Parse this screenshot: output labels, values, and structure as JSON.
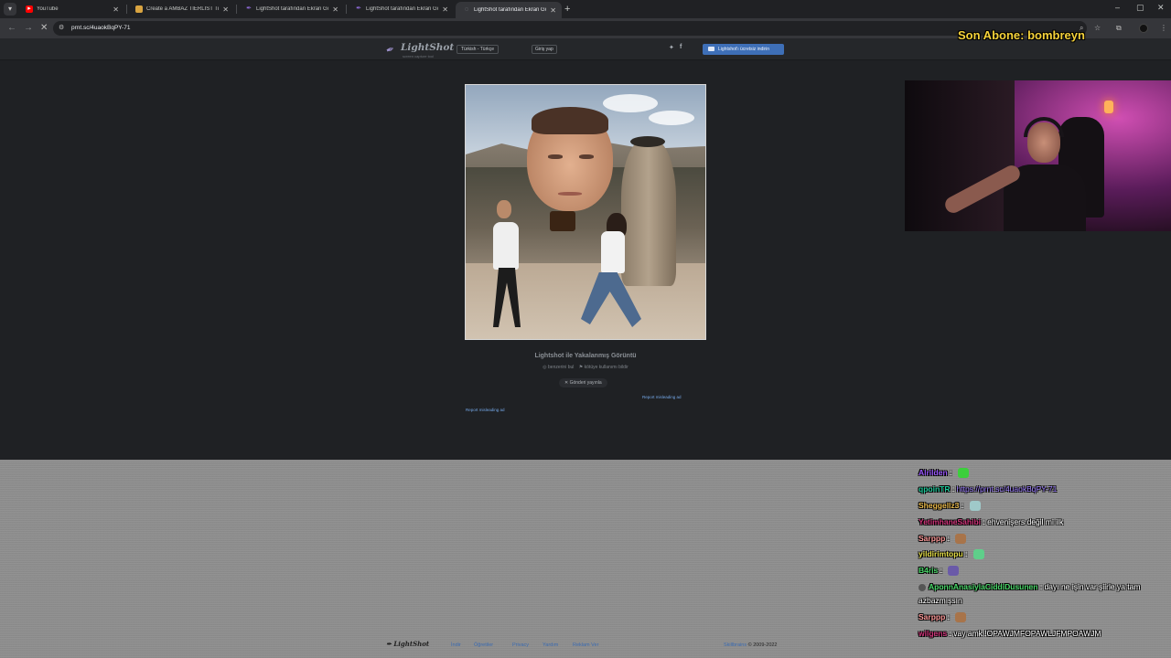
{
  "browser": {
    "tabs": [
      {
        "label": "YouTube",
        "active": false,
        "favicon": "youtube-icon",
        "color": "#ff0000"
      },
      {
        "label": "Create a AMBAZ TIERLIST Tier",
        "active": false,
        "favicon": "tiermaker-icon",
        "color": "#d9a441"
      },
      {
        "label": "LightShot tarafından Ekran Görü",
        "active": false,
        "favicon": "lightshot-icon",
        "color": "#8e6ad8"
      },
      {
        "label": "LightShot tarafından Ekran Görü",
        "active": false,
        "favicon": "lightshot-icon",
        "color": "#8e6ad8"
      },
      {
        "label": "LightShot tarafından Ekran Görü",
        "active": true,
        "favicon": "loading-icon",
        "color": "#9aa0a6"
      }
    ],
    "url": "prnt.sc/4uaokBqPY-71"
  },
  "lightshot": {
    "logo": "LightShot",
    "tagline": "screen capture tool",
    "language": "Türkish - Türkçe",
    "login": "Giriş yap",
    "download": "Lightshot'ı ücretsiz indirin",
    "caption": "Lightshot ile Yakalanmış Görüntü",
    "actions": [
      "benzerini bul",
      "kötüye kullanımı bildir"
    ],
    "post": "Gönderi yayınla",
    "report_right": "Report misleading ad",
    "report_left": "Report misleading ad"
  },
  "stream": {
    "sub_alert": "Son Abone: bombreyn"
  },
  "footer": {
    "logo": "LightShot",
    "links": [
      "İndir",
      "Öğretiler",
      "Privacy",
      "Yardım",
      "Reklam Ver"
    ],
    "brand": "Skillbrains",
    "copyright": "© 2009-2022"
  },
  "chat": [
    {
      "user": "Alrilden",
      "user_color": "#9b59ff",
      "text": "",
      "emote": "#3ccf3c",
      "link": ""
    },
    {
      "user": "qpoinTR",
      "user_color": "#1ec99a",
      "text": "",
      "emote": "",
      "link": "https://prnt.sc/4uaokBqPY-71"
    },
    {
      "user": "Sheggellz3",
      "user_color": "#e8b84a",
      "text": "",
      "emote": "#9fc9c9",
      "link": ""
    },
    {
      "user": "YetimhaneSahibi",
      "user_color": "#d0337a",
      "text": "ehvenişers değil mi ilk",
      "emote": "",
      "link": ""
    },
    {
      "user": "Sarppp",
      "user_color": "#ff9a9a",
      "text": "",
      "emote": "#a8744a",
      "link": ""
    },
    {
      "user": "yildirimtopu",
      "user_color": "#e8e14a",
      "text": "",
      "emote": "#5fcf8a",
      "link": ""
    },
    {
      "user": "B4ris",
      "user_color": "#4ad96a",
      "text": "",
      "emote": "#6a5aa8",
      "link": ""
    },
    {
      "user": "AponnAnasiylaCiddiDusunen",
      "user_color": "#4ad96a",
      "text": "dayı ne işin var şiirle ya tam",
      "emote": "",
      "link": ""
    },
    {
      "user": "",
      "user_color": "#ffffff",
      "text": "azbazmışsın",
      "emote": "",
      "link": ""
    },
    {
      "user": "Sarppp",
      "user_color": "#ff9a9a",
      "text": "",
      "emote": "#a8744a",
      "link": ""
    },
    {
      "user": "wilgens",
      "user_color": "#d0337a",
      "text": "vay amk !OPAWJMFOPAWLJFMPOAWJM",
      "emote": "",
      "link": ""
    }
  ]
}
